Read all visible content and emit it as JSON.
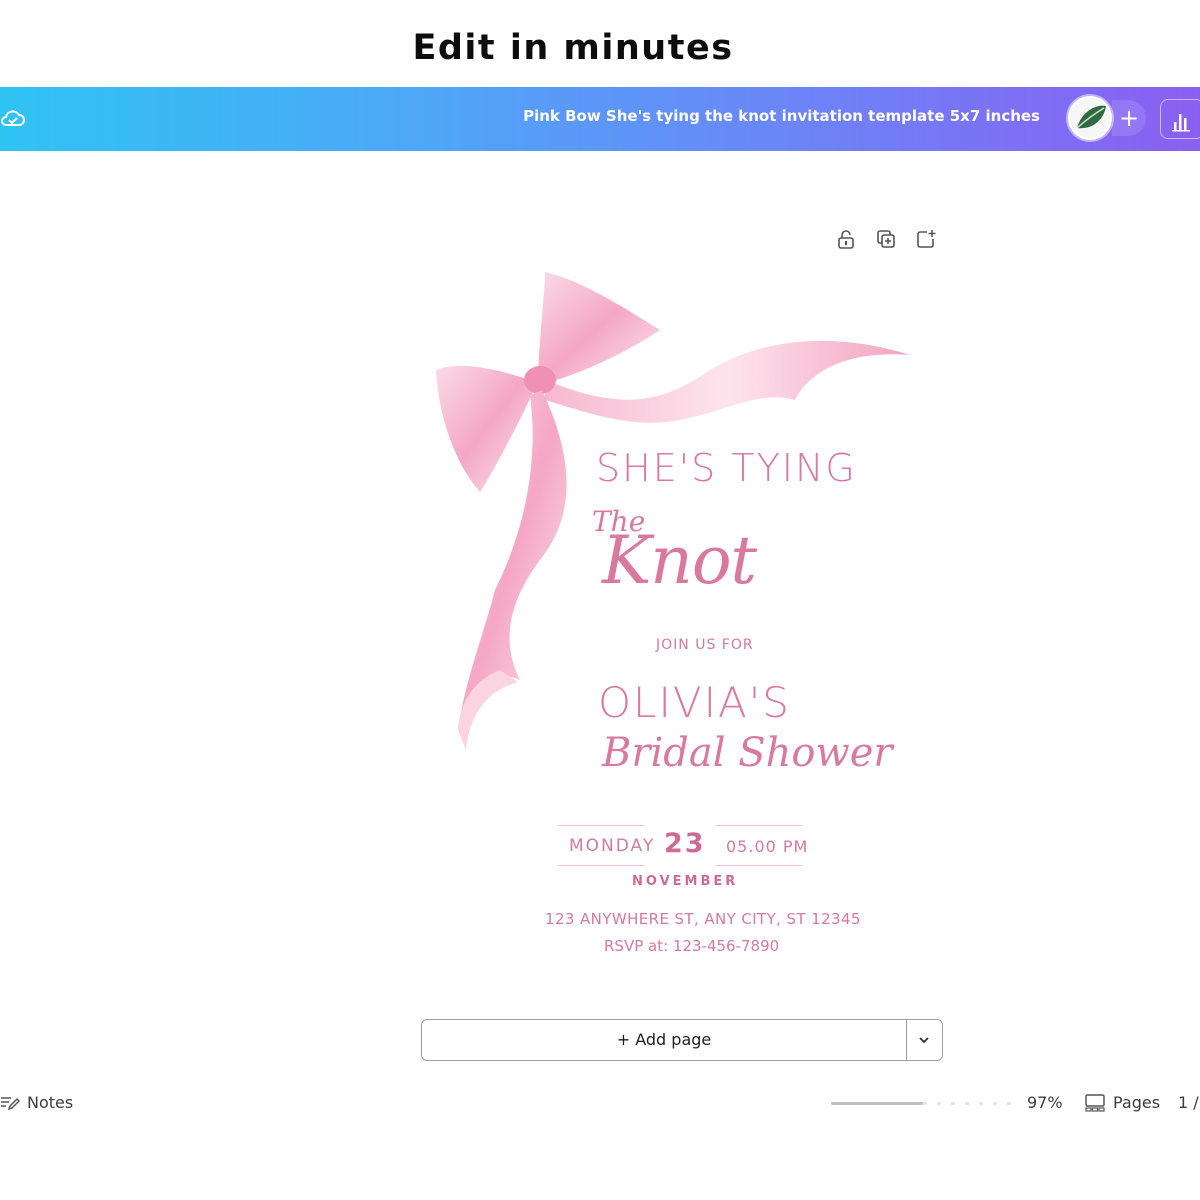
{
  "headline": "Edit in minutes",
  "topbar": {
    "document_title": "Pink Bow She's tying the knot invitation template 5x7 inches",
    "add_label": "+",
    "gradient_start": "#2fc3f2",
    "gradient_end": "#8b5ff2"
  },
  "invitation": {
    "line1": "SHE'S TYING",
    "line2_small": "The",
    "line2_large": "Knot",
    "join": "JOIN US FOR",
    "name": "OLIVIA'S",
    "event": "Bridal Shower",
    "weekday": "MONDAY",
    "day": "23",
    "time": "05.00 PM",
    "month": "NOVEMBER",
    "address": "123 ANYWHERE ST, ANY CITY, ST 12345",
    "rsvp": "RSVP at: 123-456-7890",
    "accent_color": "#d9799f"
  },
  "canvas": {
    "add_page_label": "+ Add page"
  },
  "footer": {
    "notes_label": "Notes",
    "zoom": "97%",
    "pages_label": "Pages",
    "page_count": "1 /"
  }
}
